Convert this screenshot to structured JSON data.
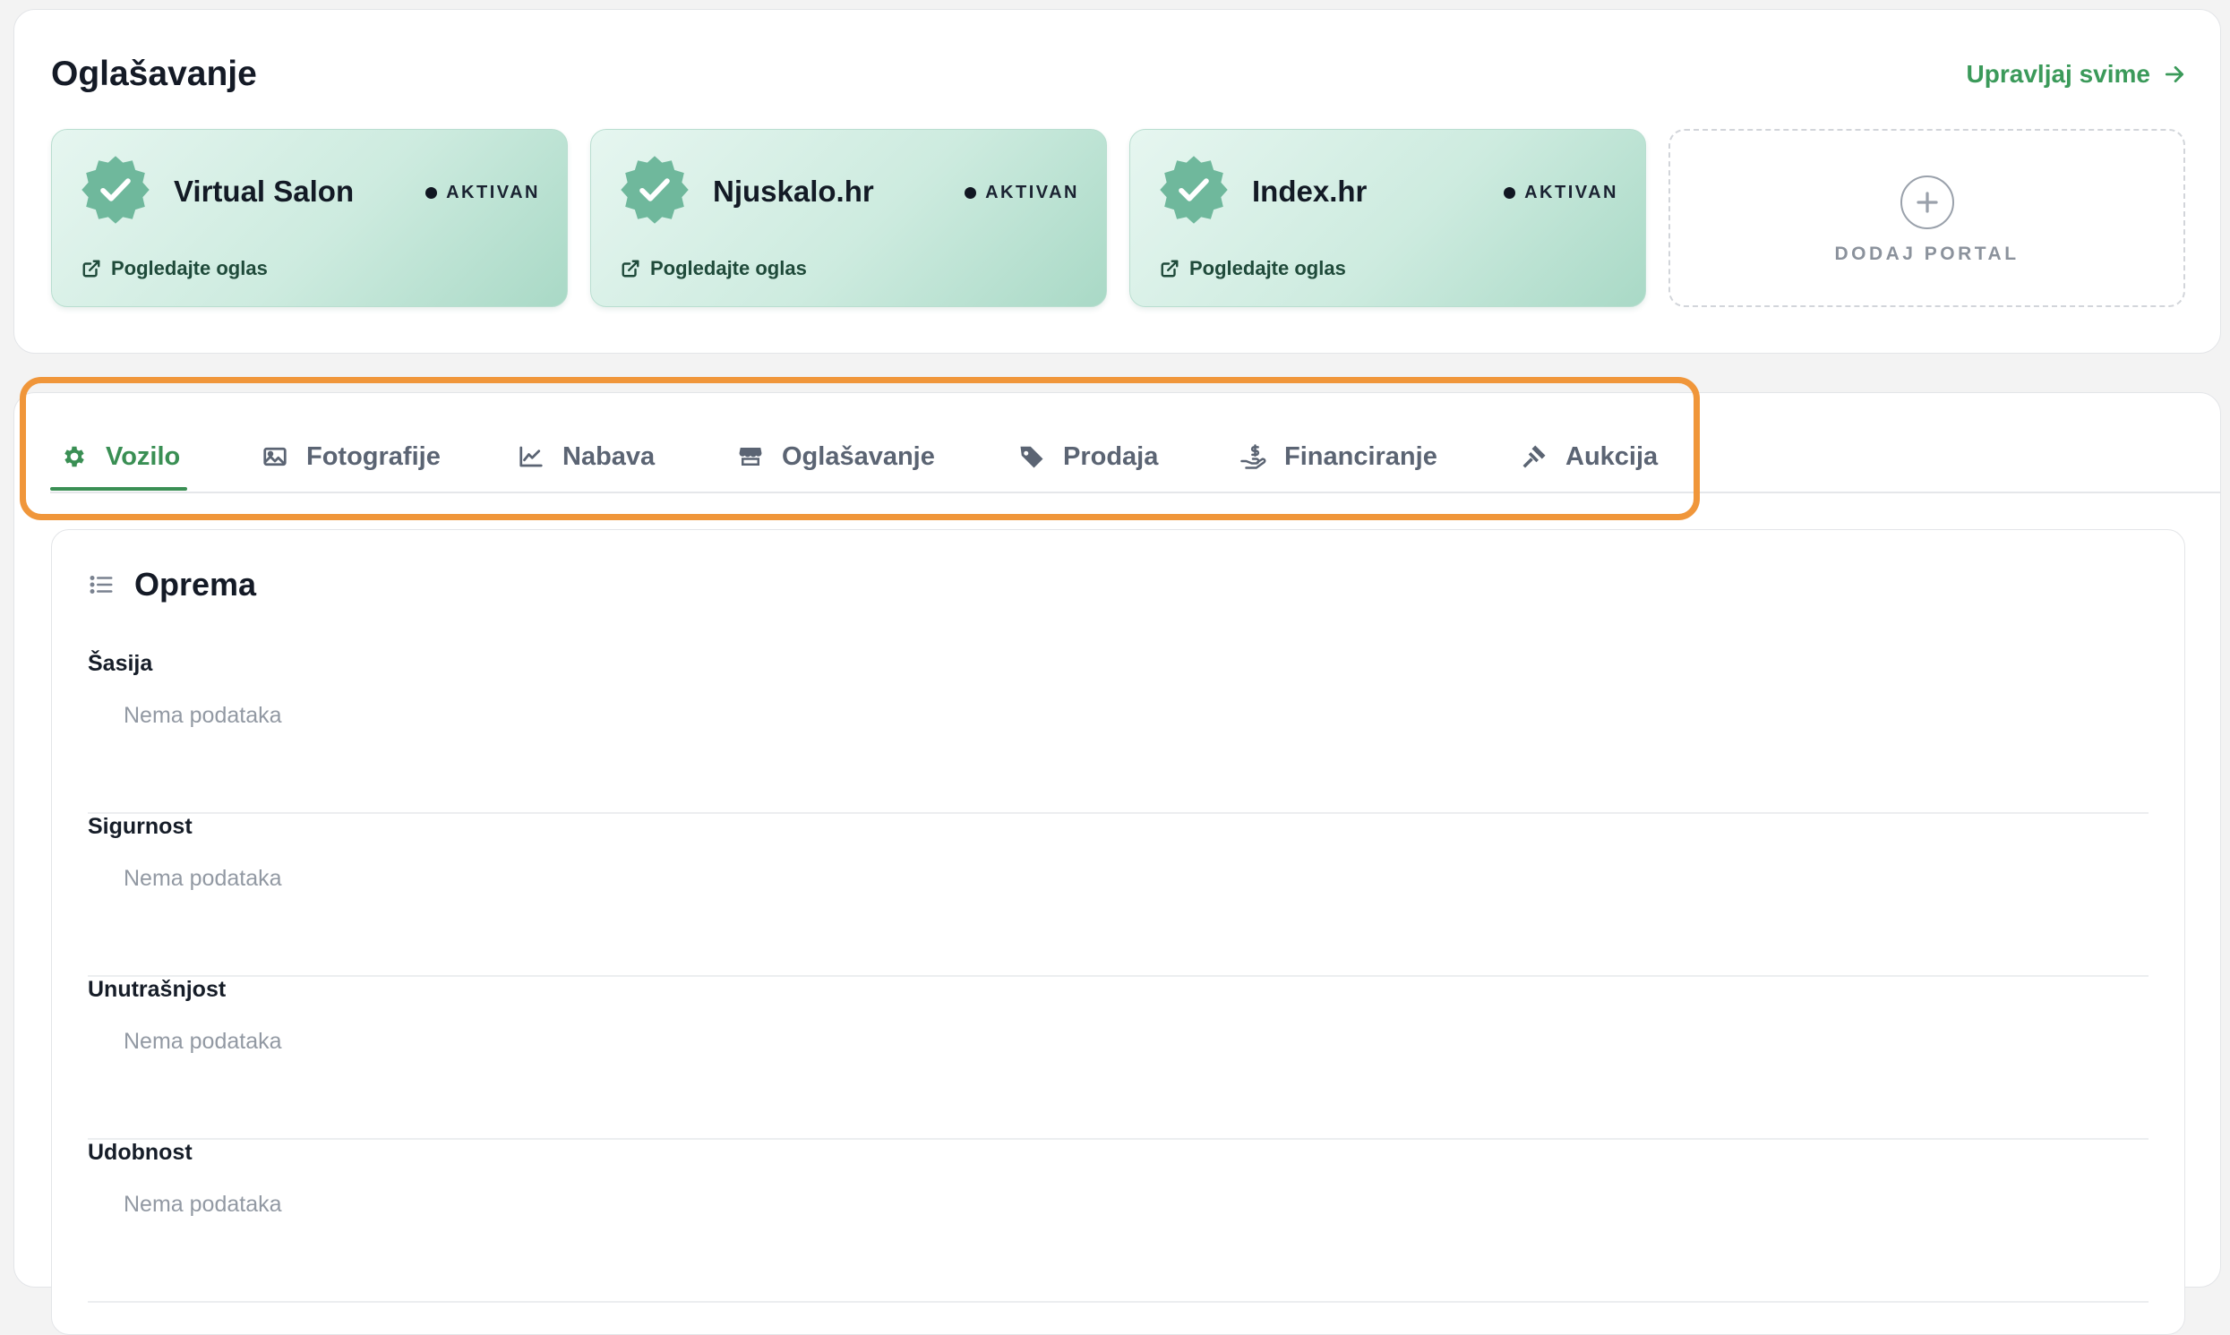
{
  "advertising": {
    "title": "Oglašavanje",
    "manage_label": "Upravljaj svime",
    "portals": [
      {
        "name": "Virtual Salon",
        "status": "AKTIVAN",
        "link_label": "Pogledajte oglas"
      },
      {
        "name": "Njuskalo.hr",
        "status": "AKTIVAN",
        "link_label": "Pogledajte oglas"
      },
      {
        "name": "Index.hr",
        "status": "AKTIVAN",
        "link_label": "Pogledajte oglas"
      }
    ],
    "add_label": "DODAJ PORTAL"
  },
  "tabs": [
    {
      "label": "Vozilo",
      "icon": "gear-icon",
      "active": true
    },
    {
      "label": "Fotografije",
      "icon": "image-icon",
      "active": false
    },
    {
      "label": "Nabava",
      "icon": "chart-line-icon",
      "active": false
    },
    {
      "label": "Oglašavanje",
      "icon": "store-icon",
      "active": false
    },
    {
      "label": "Prodaja",
      "icon": "tag-icon",
      "active": false
    },
    {
      "label": "Financiranje",
      "icon": "hand-dollar-icon",
      "active": false
    },
    {
      "label": "Aukcija",
      "icon": "gavel-icon",
      "active": false
    }
  ],
  "equipment": {
    "title": "Oprema",
    "groups": [
      {
        "label": "Šasija",
        "empty_text": "Nema podataka"
      },
      {
        "label": "Sigurnost",
        "empty_text": "Nema podataka"
      },
      {
        "label": "Unutrašnjost",
        "empty_text": "Nema podataka"
      },
      {
        "label": "Udobnost",
        "empty_text": "Nema podataka"
      }
    ]
  },
  "colors": {
    "accent_green": "#3a8f54",
    "highlight_orange": "#f0963a",
    "badge_green": "#6fb89c"
  }
}
